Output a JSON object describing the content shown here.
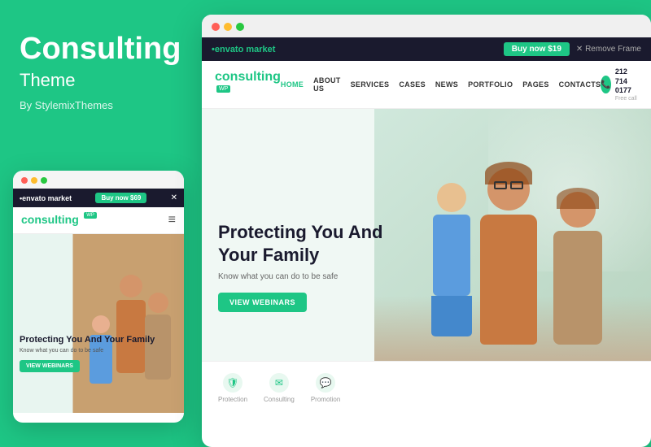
{
  "left_panel": {
    "title": "Consulting",
    "subtitle": "Theme",
    "author": "By StylemixThemes"
  },
  "mobile_preview": {
    "topbar": {
      "envato_logo": "•envato market",
      "buy_btn": "Buy now $69",
      "close": "✕"
    },
    "header": {
      "logo": "consulting",
      "wp_badge": "WP",
      "hamburger": "≡"
    },
    "hero": {
      "heading": "Protecting You And Your Family",
      "subtext": "Know what you can do to be safe",
      "cta": "VIEW WEBINARS"
    }
  },
  "desktop_preview": {
    "topbar": {
      "envato_logo": "envato market",
      "buy_btn": "Buy now $19",
      "remove": "✕ Remove Frame"
    },
    "header": {
      "logo": "consulting",
      "wp_badge": "WP",
      "nav": [
        "HOME",
        "ABOUT US",
        "SERVICES",
        "CASES",
        "NEWS",
        "PORTFOLIO",
        "PAGES",
        "CONTACTS"
      ],
      "phone": "212 714 0177",
      "phone_sub": "Free call"
    },
    "hero": {
      "heading": "Protecting You And Your Family",
      "subtext": "Know what you can do to be safe",
      "cta": "VIEW WEBINARS"
    },
    "features": [
      {
        "icon": "🛡",
        "label": "Protection"
      },
      {
        "icon": "📧",
        "label": "Consulting"
      },
      {
        "icon": "💬",
        "label": "Promotion"
      }
    ]
  },
  "colors": {
    "brand_green": "#1ec685",
    "dark_navy": "#1a1a2e",
    "white": "#ffffff"
  }
}
